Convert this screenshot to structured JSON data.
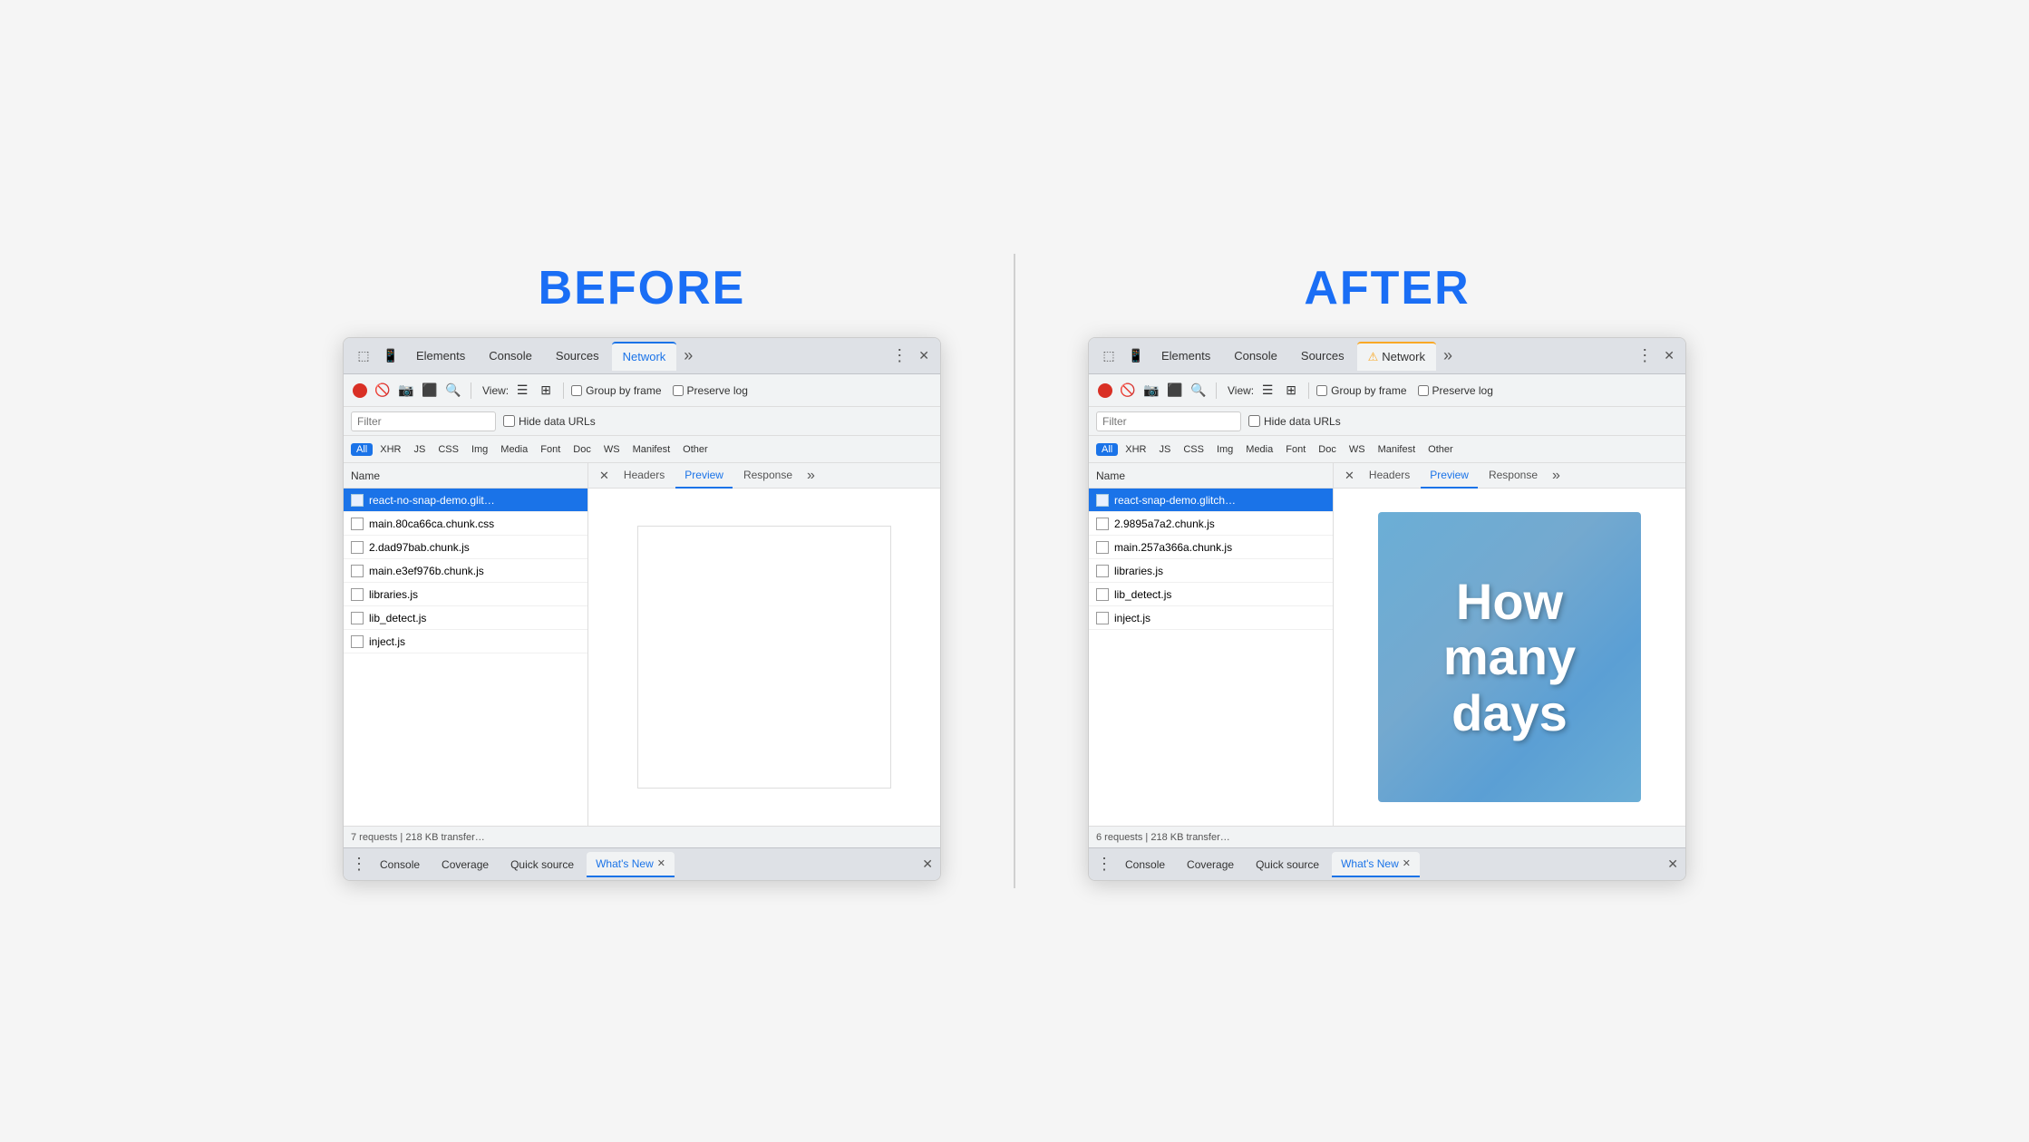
{
  "before": {
    "label": "BEFORE",
    "tabs": {
      "items": [
        "Elements",
        "Console",
        "Sources",
        "Network",
        "»"
      ],
      "active": "Network",
      "active_index": 3
    },
    "toolbar": {
      "view_label": "View:",
      "group_by_frame": "Group by frame",
      "preserve_log": "Preserve log"
    },
    "filter": {
      "placeholder": "Filter",
      "hide_data_urls": "Hide data URLs"
    },
    "types": [
      "All",
      "XHR",
      "JS",
      "CSS",
      "Img",
      "Media",
      "Font",
      "Doc",
      "WS",
      "Manifest",
      "Other"
    ],
    "active_type": "All",
    "col_headers": [
      "Name"
    ],
    "files": [
      {
        "name": "react-no-snap-demo.glit…",
        "selected": true
      },
      {
        "name": "main.80ca66ca.chunk.css",
        "selected": false
      },
      {
        "name": "2.dad97bab.chunk.js",
        "selected": false
      },
      {
        "name": "main.e3ef976b.chunk.js",
        "selected": false
      },
      {
        "name": "libraries.js",
        "selected": false
      },
      {
        "name": "lib_detect.js",
        "selected": false
      },
      {
        "name": "inject.js",
        "selected": false
      }
    ],
    "preview_tabs": [
      "×",
      "Headers",
      "Preview",
      "Response",
      "»"
    ],
    "active_preview_tab": "Preview",
    "status": "7 requests | 218 KB transfer…",
    "drawer_tabs": [
      "Console",
      "Coverage",
      "Quick source",
      "What's New"
    ],
    "active_drawer_tab": "What's New"
  },
  "after": {
    "label": "AFTER",
    "tabs": {
      "items": [
        "Elements",
        "Console",
        "Sources",
        "Network",
        "»"
      ],
      "active": "Network",
      "active_index": 3,
      "has_warning": true
    },
    "toolbar": {
      "view_label": "View:",
      "group_by_frame": "Group by frame",
      "preserve_log": "Preserve log"
    },
    "filter": {
      "placeholder": "Filter",
      "hide_data_urls": "Hide data URLs"
    },
    "types": [
      "All",
      "XHR",
      "JS",
      "CSS",
      "Img",
      "Media",
      "Font",
      "Doc",
      "WS",
      "Manifest",
      "Other"
    ],
    "active_type": "All",
    "col_headers": [
      "Name"
    ],
    "files": [
      {
        "name": "react-snap-demo.glitch…",
        "selected": true
      },
      {
        "name": "2.9895a7a2.chunk.js",
        "selected": false
      },
      {
        "name": "main.257a366a.chunk.js",
        "selected": false
      },
      {
        "name": "libraries.js",
        "selected": false
      },
      {
        "name": "lib_detect.js",
        "selected": false
      },
      {
        "name": "inject.js",
        "selected": false
      }
    ],
    "preview_tabs": [
      "×",
      "Headers",
      "Preview",
      "Response",
      "»"
    ],
    "active_preview_tab": "Preview",
    "preview_image_text": "How\nmany\ndays",
    "status": "6 requests | 218 KB transfer…",
    "drawer_tabs": [
      "Console",
      "Coverage",
      "Quick source",
      "What's New"
    ],
    "active_drawer_tab": "What's New"
  }
}
